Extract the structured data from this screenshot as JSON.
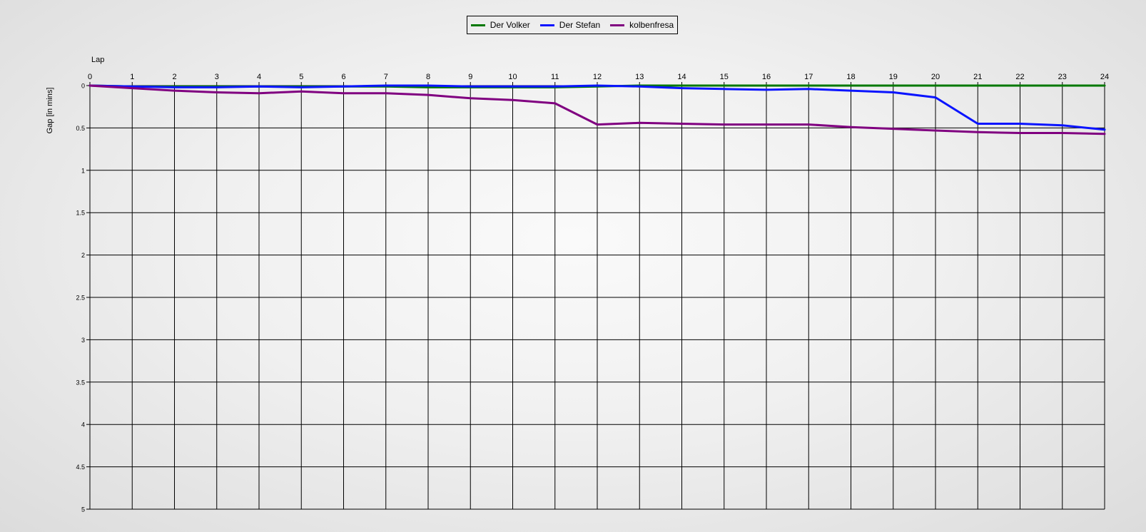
{
  "chart_data": {
    "type": "line",
    "title": "",
    "xlabel": "Lap",
    "ylabel": "Gap [in mins]",
    "x": [
      0,
      1,
      2,
      3,
      4,
      5,
      6,
      7,
      8,
      9,
      10,
      11,
      12,
      13,
      14,
      15,
      16,
      17,
      18,
      19,
      20,
      21,
      22,
      23,
      24
    ],
    "xlim": [
      0,
      24
    ],
    "ylim": [
      0,
      5
    ],
    "y_inverted": true,
    "x_axis_position": "top",
    "x_ticks": [
      "0",
      "1",
      "2",
      "3",
      "4",
      "5",
      "6",
      "7",
      "8",
      "9",
      "10",
      "11",
      "12",
      "13",
      "14",
      "15",
      "16",
      "17",
      "18",
      "19",
      "20",
      "21",
      "22",
      "23",
      "24"
    ],
    "y_ticks": [
      0,
      0.5,
      1,
      1.5,
      2,
      2.5,
      3,
      3.5,
      4,
      4.5,
      5
    ],
    "grid": true,
    "legend_position": "top-center",
    "series": [
      {
        "name": "Der Volker",
        "color": "#007800",
        "values": [
          0,
          0.01,
          0.01,
          0.01,
          0.01,
          0.01,
          0.01,
          0.01,
          0.02,
          0.02,
          0.02,
          0.02,
          0.01,
          0,
          0,
          0,
          0,
          0,
          0,
          0,
          0,
          0,
          0,
          0,
          0
        ]
      },
      {
        "name": "Der Stefan",
        "color": "#0a14ff",
        "values": [
          0,
          0.01,
          0.02,
          0.02,
          0.01,
          0.02,
          0.01,
          0,
          0,
          0.01,
          0.01,
          0.01,
          0,
          0.01,
          0.03,
          0.04,
          0.05,
          0.04,
          0.06,
          0.08,
          0.14,
          0.45,
          0.45,
          0.47,
          0.52
        ]
      },
      {
        "name": "kolbenfresa",
        "color": "#800080",
        "values": [
          0,
          0.03,
          0.06,
          0.08,
          0.09,
          0.07,
          0.09,
          0.09,
          0.11,
          0.15,
          0.17,
          0.21,
          0.46,
          0.44,
          0.45,
          0.46,
          0.46,
          0.46,
          0.49,
          0.51,
          0.53,
          0.55,
          0.56,
          0.56,
          0.57
        ]
      }
    ]
  }
}
